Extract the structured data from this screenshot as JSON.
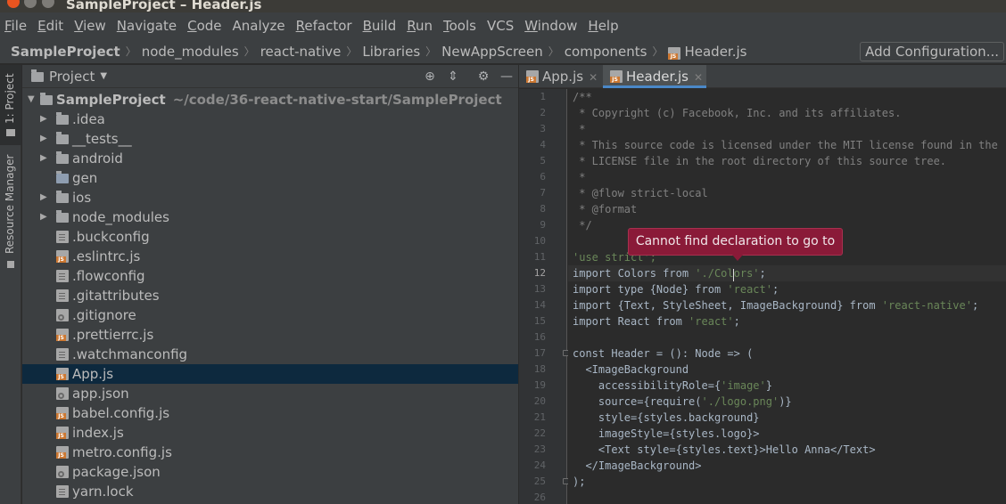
{
  "window": {
    "title": "SampleProject – Header.js"
  },
  "menu": [
    {
      "label": "File",
      "key": "F",
      "rest": "ile"
    },
    {
      "label": "Edit",
      "key": "E",
      "rest": "dit"
    },
    {
      "label": "View",
      "key": "V",
      "rest": "iew"
    },
    {
      "label": "Navigate",
      "key": "N",
      "rest": "avigate"
    },
    {
      "label": "Code",
      "key": "C",
      "rest": "ode"
    },
    {
      "label": "Analyze",
      "key": "",
      "rest": "Analyze"
    },
    {
      "label": "Refactor",
      "key": "R",
      "rest": "efactor"
    },
    {
      "label": "Build",
      "key": "B",
      "rest": "uild"
    },
    {
      "label": "Run",
      "key": "R",
      "rest": "un"
    },
    {
      "label": "Tools",
      "key": "T",
      "rest": "ools"
    },
    {
      "label": "VCS",
      "key": "",
      "rest": "VCS"
    },
    {
      "label": "Window",
      "key": "W",
      "rest": "indow"
    },
    {
      "label": "Help",
      "key": "H",
      "rest": "elp"
    }
  ],
  "breadcrumbs": [
    "SampleProject",
    "node_modules",
    "react-native",
    "Libraries",
    "NewAppScreen",
    "components",
    "Header.js"
  ],
  "run_config": {
    "label": "Add Configuration..."
  },
  "tool_strip": {
    "project_tab": "1: Project",
    "resource_manager_tab": "Resource Manager"
  },
  "project_panel": {
    "title": "Project",
    "root": {
      "name": "SampleProject",
      "path": "~/code/36-react-native-start/SampleProject"
    },
    "items": [
      {
        "name": ".idea",
        "type": "folder",
        "expandable": true
      },
      {
        "name": "__tests__",
        "type": "folder",
        "expandable": true
      },
      {
        "name": "android",
        "type": "folder",
        "expandable": true
      },
      {
        "name": "gen",
        "type": "modfolder",
        "expandable": false
      },
      {
        "name": "ios",
        "type": "folder",
        "expandable": true
      },
      {
        "name": "node_modules",
        "type": "folder",
        "expandable": true
      },
      {
        "name": ".buckconfig",
        "type": "txt"
      },
      {
        "name": ".eslintrc.js",
        "type": "js"
      },
      {
        "name": ".flowconfig",
        "type": "txt"
      },
      {
        "name": ".gitattributes",
        "type": "txt"
      },
      {
        "name": ".gitignore",
        "type": "cfg"
      },
      {
        "name": ".prettierrc.js",
        "type": "js"
      },
      {
        "name": ".watchmanconfig",
        "type": "txt"
      },
      {
        "name": "App.js",
        "type": "js",
        "selected": true
      },
      {
        "name": "app.json",
        "type": "cfg"
      },
      {
        "name": "babel.config.js",
        "type": "js"
      },
      {
        "name": "index.js",
        "type": "js"
      },
      {
        "name": "metro.config.js",
        "type": "js"
      },
      {
        "name": "package.json",
        "type": "cfg"
      },
      {
        "name": "yarn.lock",
        "type": "txt"
      }
    ]
  },
  "editor": {
    "tabs": [
      {
        "label": "App.js",
        "active": false
      },
      {
        "label": "Header.js",
        "active": true
      }
    ],
    "current_line": 12,
    "lines": [
      {
        "n": 1,
        "parts": [
          [
            "c-com",
            "/**"
          ]
        ]
      },
      {
        "n": 2,
        "parts": [
          [
            "c-com",
            " * Copyright (c) Facebook, Inc. and its affiliates."
          ]
        ]
      },
      {
        "n": 3,
        "parts": [
          [
            "c-com",
            " *"
          ]
        ]
      },
      {
        "n": 4,
        "parts": [
          [
            "c-com",
            " * This source code is licensed under the MIT license found in the"
          ]
        ]
      },
      {
        "n": 5,
        "parts": [
          [
            "c-com",
            " * LICENSE file in the root directory of this source tree."
          ]
        ]
      },
      {
        "n": 6,
        "parts": [
          [
            "c-com",
            " *"
          ]
        ]
      },
      {
        "n": 7,
        "parts": [
          [
            "c-com",
            " * @flow strict-local"
          ]
        ]
      },
      {
        "n": 8,
        "parts": [
          [
            "c-com",
            " * @format"
          ]
        ]
      },
      {
        "n": 9,
        "parts": [
          [
            "c-com",
            " */"
          ]
        ]
      },
      {
        "n": 10,
        "parts": []
      },
      {
        "n": 11,
        "parts": [
          [
            "c-str",
            "'use strict';"
          ]
        ]
      },
      {
        "n": 12,
        "parts": [
          [
            "c-kw",
            "import Colors from "
          ],
          [
            "c-str",
            "'./Colors'"
          ],
          [
            "c-kw",
            ";"
          ]
        ]
      },
      {
        "n": 13,
        "parts": [
          [
            "c-kw",
            "import type {Node} from "
          ],
          [
            "c-str",
            "'react'"
          ],
          [
            "c-kw",
            ";"
          ]
        ]
      },
      {
        "n": 14,
        "parts": [
          [
            "c-kw",
            "import {Text, StyleSheet, ImageBackground} from "
          ],
          [
            "c-str",
            "'react-native'"
          ],
          [
            "c-kw",
            ";"
          ]
        ]
      },
      {
        "n": 15,
        "parts": [
          [
            "c-kw",
            "import React from "
          ],
          [
            "c-str",
            "'react'"
          ],
          [
            "c-kw",
            ";"
          ]
        ]
      },
      {
        "n": 16,
        "parts": []
      },
      {
        "n": 17,
        "parts": [
          [
            "c-kw",
            "const Header = (): Node => ("
          ]
        ]
      },
      {
        "n": 18,
        "parts": [
          [
            "c-kw",
            "  <ImageBackground"
          ]
        ]
      },
      {
        "n": 19,
        "parts": [
          [
            "c-kw",
            "    accessibilityRole={"
          ],
          [
            "c-str",
            "'image'"
          ],
          [
            "c-kw",
            "}"
          ]
        ]
      },
      {
        "n": 20,
        "parts": [
          [
            "c-kw",
            "    source={require("
          ],
          [
            "c-str",
            "'./logo.png'"
          ],
          [
            "c-kw",
            ")}"
          ]
        ]
      },
      {
        "n": 21,
        "parts": [
          [
            "c-kw",
            "    style={styles.background}"
          ]
        ]
      },
      {
        "n": 22,
        "parts": [
          [
            "c-kw",
            "    imageStyle={styles.logo}>"
          ]
        ]
      },
      {
        "n": 23,
        "parts": [
          [
            "c-kw",
            "    <Text style={styles.text}>Hello Anna</Text>"
          ]
        ]
      },
      {
        "n": 24,
        "parts": [
          [
            "c-kw",
            "  </ImageBackground>"
          ]
        ]
      },
      {
        "n": 25,
        "parts": [
          [
            "c-kw",
            ");"
          ]
        ]
      },
      {
        "n": 26,
        "parts": []
      }
    ]
  },
  "tooltip": {
    "text": "Cannot find declaration to go to"
  }
}
